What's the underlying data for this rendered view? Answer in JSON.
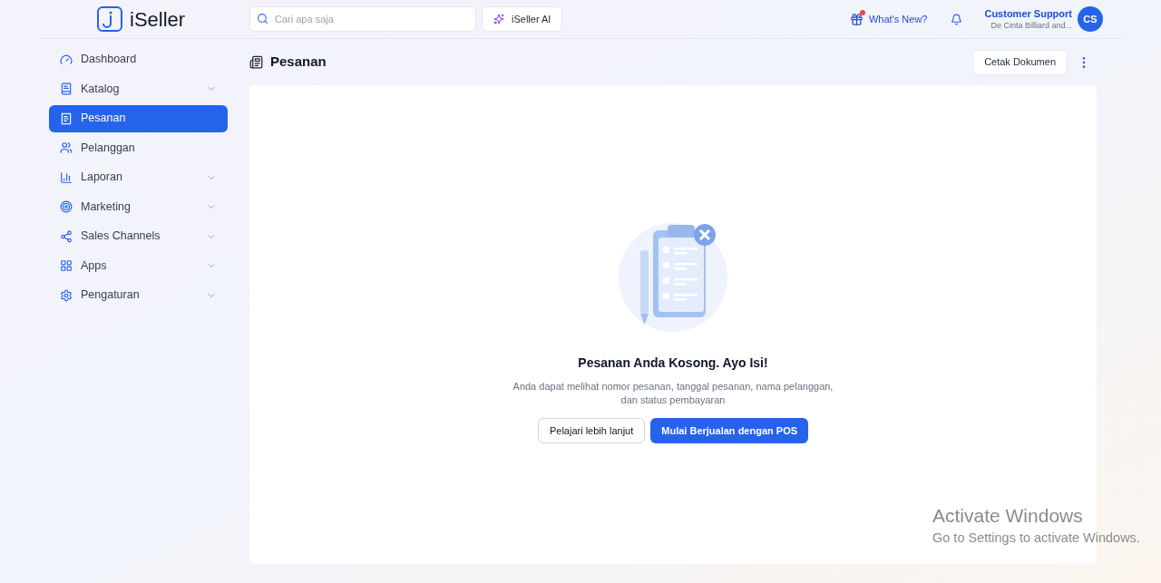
{
  "header": {
    "logo": "iSeller",
    "search": {
      "placeholder": "Cari apa saja"
    },
    "ai_button": "iSeller AI",
    "whats_new": {
      "label": "What's New?",
      "unread": true
    },
    "user": {
      "name": "Customer Support",
      "store": "De Cinta Billiard and...",
      "initials": "CS"
    }
  },
  "sidebar": {
    "items": [
      {
        "label": "Dashboard",
        "selected": false,
        "expandable": false
      },
      {
        "label": "Katalog",
        "selected": false,
        "expandable": true
      },
      {
        "label": "Pesanan",
        "selected": true,
        "expandable": false
      },
      {
        "label": "Pelanggan",
        "selected": false,
        "expandable": false
      },
      {
        "label": "Laporan",
        "selected": false,
        "expandable": true
      },
      {
        "label": "Marketing",
        "selected": false,
        "expandable": true
      },
      {
        "label": "Sales Channels",
        "selected": false,
        "expandable": true
      },
      {
        "label": "Apps",
        "selected": false,
        "expandable": true
      },
      {
        "label": "Pengaturan",
        "selected": false,
        "expandable": true
      }
    ]
  },
  "page": {
    "title": "Pesanan",
    "print_button": "Cetak Dokumen"
  },
  "empty_state": {
    "title": "Pesanan Anda Kosong. Ayo Isi!",
    "description": "Anda dapat melihat nomor pesanan, tanggal pesanan, nama pelanggan, dan status pembayaran",
    "secondary_button": "Pelajari lebih lanjut",
    "primary_button": "Mulai Berjualan dengan POS"
  },
  "os_notice": {
    "title": "Activate Windows",
    "message": "Go to Settings to activate Windows."
  }
}
